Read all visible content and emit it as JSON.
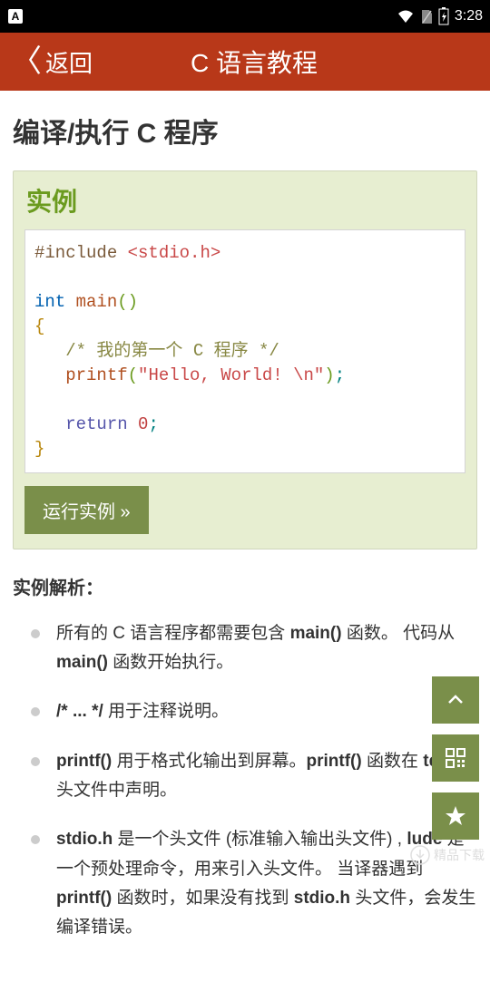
{
  "status": {
    "time": "3:28"
  },
  "appbar": {
    "back": "返回",
    "title": "C 语言教程"
  },
  "section": {
    "title": "编译/执行 C 程序"
  },
  "example": {
    "label": "实例",
    "run_btn": "运行实例 »"
  },
  "code": {
    "l1_directive": "#include",
    "l1_header": "<stdio.h>",
    "l2_type": "int",
    "l2_main": "main",
    "l2_parens": "()",
    "l3_brace": "{",
    "l4_comment": "/* 我的第一个 C 程序 */",
    "l5_printf": "printf",
    "l5_open": "(",
    "l5_str": "\"Hello, World! \\n\"",
    "l5_close": ")",
    "l5_semi": ";",
    "l6_return": "return",
    "l6_zero": "0",
    "l6_semi": ";",
    "l7_brace": "}"
  },
  "analysis": {
    "title": "实例解析："
  },
  "bullets": {
    "b1_a": "所有的 C 语言程序都需要包含 ",
    "b1_b": "main()",
    "b1_c": " 函数。 代码从 ",
    "b1_d": "main()",
    "b1_e": " 函数开始执行。",
    "b2_a": "/* ... */",
    "b2_b": " 用于注释说明。",
    "b3_a": "printf()",
    "b3_b": " 用于格式化输出到屏幕。",
    "b3_c": "printf()",
    "b3_d": " 函数在 ",
    "b3_e": "tdio.h",
    "b3_f": "\" 头文件中声明。",
    "b4_a": "stdio.h",
    "b4_b": " 是一个头文件 (标准输入输出头文件) , ",
    "b4_c": "lude",
    "b4_d": " 是一个预处理命令，用来引入头文件。 当译器遇到 ",
    "b4_e": "printf()",
    "b4_f": " 函数时，如果没有找到 ",
    "b4_g": "stdio.h",
    "b4_h": " 头文件，会发生编译错误。"
  },
  "watermark": "精品下载"
}
